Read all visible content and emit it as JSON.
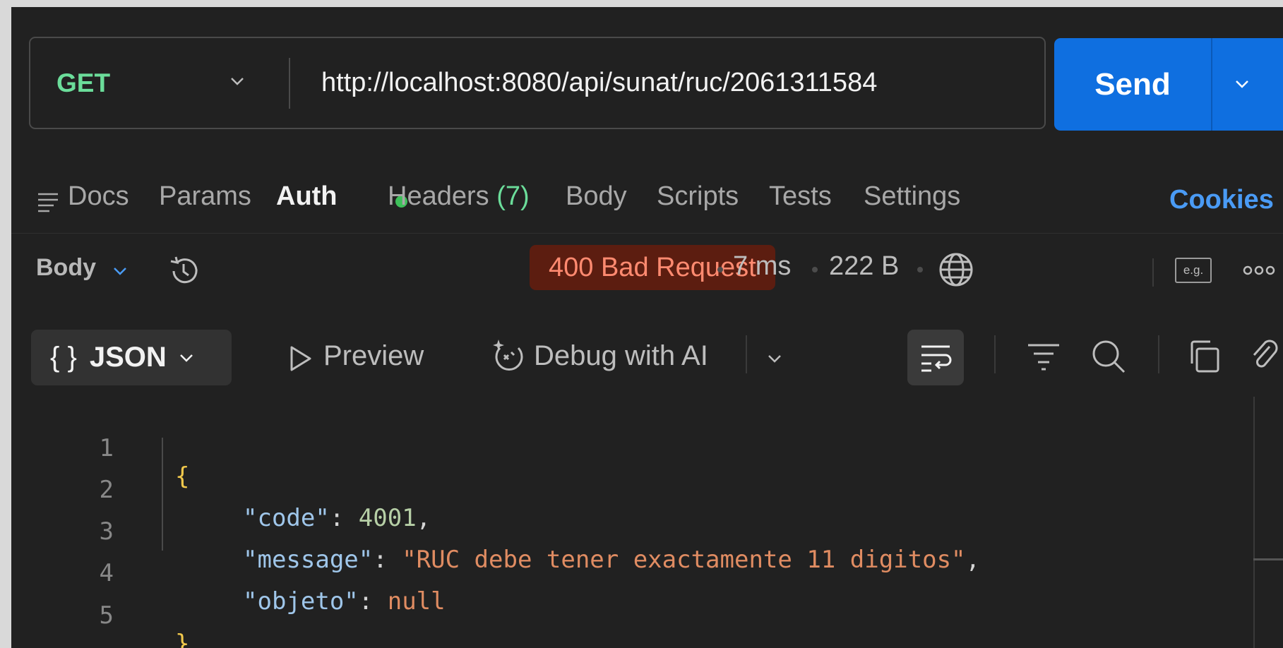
{
  "request": {
    "method": "GET",
    "url": "http://localhost:8080/api/sunat/ruc/2061311584",
    "send_label": "Send"
  },
  "tabs": [
    {
      "label": "Docs"
    },
    {
      "label": "Params"
    },
    {
      "label": "Auth"
    },
    {
      "label": "Headers",
      "count": "(7)"
    },
    {
      "label": "Body"
    },
    {
      "label": "Scripts"
    },
    {
      "label": "Tests"
    },
    {
      "label": "Settings"
    }
  ],
  "cookies_label": "Cookies",
  "response": {
    "view_label": "Body",
    "status": "400 Bad Request",
    "time": "7 ms",
    "size": "222 B",
    "eg_label": "e.g."
  },
  "viewer": {
    "format_label": "JSON",
    "format_braces": "{ }",
    "preview_label": "Preview",
    "debug_label": "Debug with AI"
  },
  "code": {
    "line_numbers": [
      "1",
      "2",
      "3",
      "4",
      "5"
    ],
    "open_brace": "{",
    "close_brace": "}",
    "code_key": "\"code\"",
    "code_value": "4001",
    "message_key": "\"message\"",
    "message_value": "\"RUC debe tener exactamente 11 digitos\"",
    "objeto_key": "\"objeto\"",
    "objeto_value": "null",
    "colon": ": ",
    "comma": ","
  },
  "colors": {
    "method": "#6bdd9a",
    "send": "#0f6fe0",
    "status_bg": "#5c1d10",
    "status_text": "#ff8a70",
    "cookies": "#4a9bf5"
  }
}
